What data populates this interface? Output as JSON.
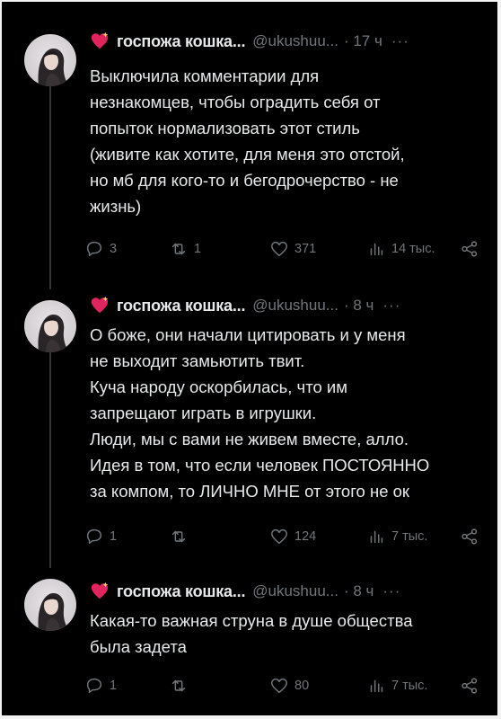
{
  "tweets": [
    {
      "author": "госпожа кошка...",
      "handle": "@ukushuu...",
      "time": "· 17 ч",
      "more": "···",
      "lines": [
        "Выключила комментарии для",
        "незнакомцев, чтобы оградить себя от",
        "попыток нормализовать этот стиль",
        "(живите как хотите, для меня это отстой,",
        "но мб для кого-то и бегодрочерство - не",
        "жизнь)"
      ],
      "replies": "3",
      "reposts": "1",
      "likes": "371",
      "views": "14 тыс."
    },
    {
      "author": "госпожа кошка...",
      "handle": "@ukushuu...",
      "time": "· 8 ч",
      "more": "···",
      "lines": [
        "О боже, они начали цитировать и у меня",
        "не выходит замьютить твит.",
        "Куча народу оскорбилась, что им",
        "запрещают играть в игрушки.",
        "Люди, мы с вами не живем вместе, алло.",
        "Идея в том, что если человек ПОСТОЯННО",
        "за компом, то ЛИЧНО МНЕ от этого не ок"
      ],
      "replies": "1",
      "reposts": "",
      "likes": "124",
      "views": "7 тыс."
    },
    {
      "author": "госпожа кошка...",
      "handle": "@ukushuu...",
      "time": "· 8 ч",
      "more": "···",
      "lines": [
        "Какая-то важная струна в душе общества",
        "была задета"
      ],
      "replies": "1",
      "reposts": "",
      "likes": "80",
      "views": "7 тыс."
    }
  ],
  "colors": {
    "background": "#000000",
    "text": "#e7e9ea",
    "muted": "#71767b",
    "thread_line": "#333639",
    "heart": "#e0245e"
  },
  "icons": [
    "heart-emoji-icon",
    "reply-icon",
    "repost-icon",
    "like-icon",
    "views-icon",
    "share-icon"
  ]
}
